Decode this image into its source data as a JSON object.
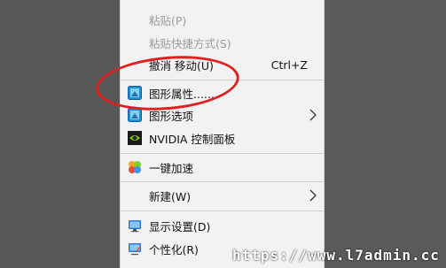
{
  "menu": {
    "paste": "粘贴(P)",
    "paste_shortcut": "粘贴快捷方式(S)",
    "undo_move": "撤消 移动(U)",
    "undo_move_shortcut": "Ctrl+Z",
    "graphics_properties": "图形属性......",
    "graphics_options": "图形选项",
    "nvidia_control_panel": "NVIDIA 控制面板",
    "one_key_accelerate": "一键加速",
    "new": "新建(W)",
    "display_settings": "显示设置(D)",
    "personalize": "个性化(R)"
  },
  "watermark": "https://www.l7admin.cc",
  "colors": {
    "menu_bg": "#f2f2f2",
    "disabled_text": "#9a9a9a",
    "annotation_red": "#e0201e",
    "nvidia_green": "#76b900"
  },
  "icons": {
    "graphics_properties": "intel-graphics-icon",
    "graphics_options": "intel-graphics-icon",
    "nvidia_control_panel": "nvidia-icon",
    "one_key_accelerate": "accelerate-icon",
    "display_settings": "monitor-icon",
    "personalize": "personalize-icon"
  }
}
